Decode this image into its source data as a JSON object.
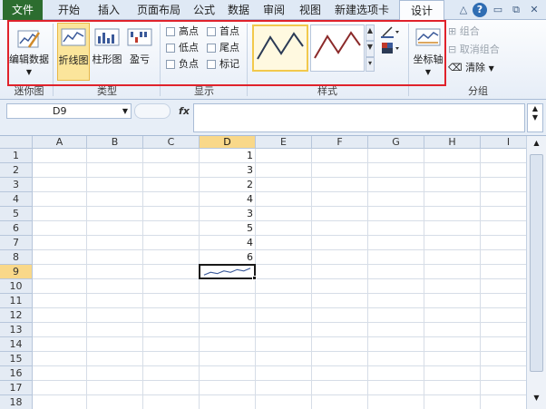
{
  "tabs": {
    "file": "文件",
    "home": "开始",
    "insert": "插入",
    "page_layout": "页面布局",
    "formulas": "公式",
    "data": "数据",
    "review": "审阅",
    "view": "视图",
    "new_tab": "新建选项卡",
    "design": "设计"
  },
  "window_controls": {
    "collapse": "△",
    "help": "?",
    "minimize": "▭",
    "restore": "⧉",
    "close": "✕"
  },
  "ribbon": {
    "sparkline_group": {
      "edit_data": "编辑数据",
      "label": "迷你图"
    },
    "type_group": {
      "line": "折线图",
      "column": "柱形图",
      "winloss": "盈亏",
      "label": "类型"
    },
    "show_group": {
      "high_point": "高点",
      "low_point": "低点",
      "negative_point": "负点",
      "first_point": "首点",
      "last_point": "尾点",
      "markers": "标记",
      "label": "显示"
    },
    "style_group": {
      "label": "样式"
    },
    "axis_label": "坐标轴",
    "group_group": {
      "group": "组合",
      "ungroup": "取消组合",
      "clear": "清除",
      "label": "分组"
    }
  },
  "formula_bar": {
    "name_box": "D9",
    "fx": "fx",
    "formula": ""
  },
  "grid": {
    "columns": [
      "A",
      "B",
      "C",
      "D",
      "E",
      "F",
      "G",
      "H",
      "I"
    ],
    "rows": [
      "1",
      "2",
      "3",
      "4",
      "5",
      "6",
      "7",
      "8",
      "9",
      "10",
      "11",
      "12",
      "13",
      "14",
      "15",
      "16",
      "17",
      "18"
    ],
    "selected_cell": "D9",
    "column_d_values": [
      "1",
      "3",
      "2",
      "4",
      "3",
      "5",
      "4",
      "6"
    ]
  },
  "colors": {
    "file_tab": "#2c6d2f",
    "highlight": "#e0222b",
    "selection": "#f9d889",
    "sparkline": "#3b5a9a"
  }
}
